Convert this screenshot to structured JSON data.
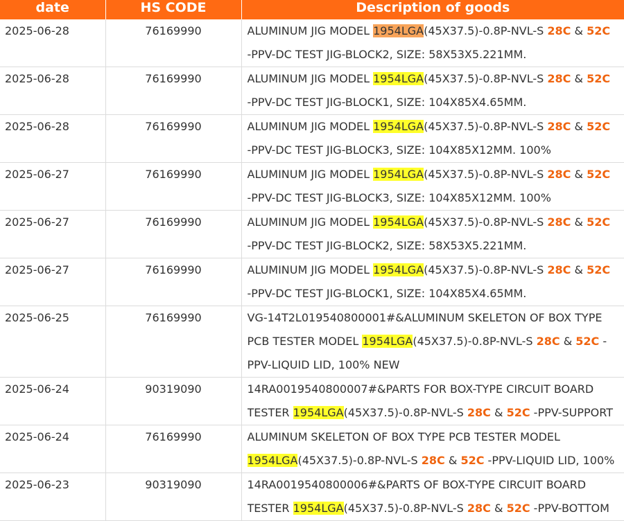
{
  "headers": {
    "date": "date",
    "hs_code": "HS CODE",
    "description": "Description of goods"
  },
  "rows": [
    {
      "date": "2025-06-28",
      "hs_code": "76169990",
      "highlight": "orange",
      "lines": [
        [
          {
            "t": "ALUMINUM JIG MODEL "
          },
          {
            "t": "1954LGA",
            "s": "hl"
          },
          {
            "t": "(45X37.5)-0.8P-NVL-S "
          },
          {
            "t": "28C",
            "s": "temp"
          },
          {
            "t": " & "
          },
          {
            "t": "52C",
            "s": "temp"
          }
        ],
        [
          {
            "t": "-PPV-DC TEST JIG-BLOCK2, SIZE: 58X53X5.221MM."
          }
        ]
      ]
    },
    {
      "date": "2025-06-28",
      "hs_code": "76169990",
      "highlight": "yellow",
      "lines": [
        [
          {
            "t": "ALUMINUM JIG MODEL "
          },
          {
            "t": "1954LGA",
            "s": "hl"
          },
          {
            "t": "(45X37.5)-0.8P-NVL-S "
          },
          {
            "t": "28C",
            "s": "temp"
          },
          {
            "t": " & "
          },
          {
            "t": "52C",
            "s": "temp"
          }
        ],
        [
          {
            "t": "-PPV-DC TEST JIG-BLOCK1, SIZE: 104X85X4.65MM."
          }
        ]
      ]
    },
    {
      "date": "2025-06-28",
      "hs_code": "76169990",
      "highlight": "yellow",
      "lines": [
        [
          {
            "t": "ALUMINUM JIG MODEL "
          },
          {
            "t": "1954LGA",
            "s": "hl"
          },
          {
            "t": "(45X37.5)-0.8P-NVL-S "
          },
          {
            "t": "28C",
            "s": "temp"
          },
          {
            "t": " & "
          },
          {
            "t": "52C",
            "s": "temp"
          }
        ],
        [
          {
            "t": "-PPV-DC TEST JIG-BLOCK3, SIZE: 104X85X12MM. 100%"
          }
        ]
      ]
    },
    {
      "date": "2025-06-27",
      "hs_code": "76169990",
      "highlight": "yellow",
      "lines": [
        [
          {
            "t": "ALUMINUM JIG MODEL "
          },
          {
            "t": "1954LGA",
            "s": "hl"
          },
          {
            "t": "(45X37.5)-0.8P-NVL-S "
          },
          {
            "t": "28C",
            "s": "temp"
          },
          {
            "t": " & "
          },
          {
            "t": "52C",
            "s": "temp"
          }
        ],
        [
          {
            "t": "-PPV-DC TEST JIG-BLOCK3, SIZE: 104X85X12MM. 100%"
          }
        ]
      ]
    },
    {
      "date": "2025-06-27",
      "hs_code": "76169990",
      "highlight": "yellow",
      "lines": [
        [
          {
            "t": "ALUMINUM JIG MODEL "
          },
          {
            "t": "1954LGA",
            "s": "hl"
          },
          {
            "t": "(45X37.5)-0.8P-NVL-S "
          },
          {
            "t": "28C",
            "s": "temp"
          },
          {
            "t": " & "
          },
          {
            "t": "52C",
            "s": "temp"
          }
        ],
        [
          {
            "t": "-PPV-DC TEST JIG-BLOCK2, SIZE: 58X53X5.221MM."
          }
        ]
      ]
    },
    {
      "date": "2025-06-27",
      "hs_code": "76169990",
      "highlight": "yellow",
      "lines": [
        [
          {
            "t": "ALUMINUM JIG MODEL "
          },
          {
            "t": "1954LGA",
            "s": "hl"
          },
          {
            "t": "(45X37.5)-0.8P-NVL-S "
          },
          {
            "t": "28C",
            "s": "temp"
          },
          {
            "t": " & "
          },
          {
            "t": "52C",
            "s": "temp"
          }
        ],
        [
          {
            "t": "-PPV-DC TEST JIG-BLOCK1, SIZE: 104X85X4.65MM."
          }
        ]
      ]
    },
    {
      "date": "2025-06-25",
      "hs_code": "76169990",
      "highlight": "yellow",
      "lines": [
        [
          {
            "t": "VG-14T2L019540800001#&ALUMINUM SKELETON OF BOX TYPE"
          }
        ],
        [
          {
            "t": "PCB TESTER MODEL "
          },
          {
            "t": "1954LGA",
            "s": "hl"
          },
          {
            "t": "(45X37.5)-0.8P-NVL-S "
          },
          {
            "t": "28C",
            "s": "temp"
          },
          {
            "t": " & "
          },
          {
            "t": "52C",
            "s": "temp"
          },
          {
            "t": " -"
          }
        ],
        [
          {
            "t": "PPV-LIQUID LID, 100% NEW"
          }
        ]
      ]
    },
    {
      "date": "2025-06-24",
      "hs_code": "90319090",
      "highlight": "yellow",
      "lines": [
        [
          {
            "t": "14RA0019540800007#&PARTS FOR BOX-TYPE CIRCUIT BOARD"
          }
        ],
        [
          {
            "t": "TESTER "
          },
          {
            "t": "1954LGA",
            "s": "hl"
          },
          {
            "t": "(45X37.5)-0.8P-NVL-S "
          },
          {
            "t": "28C",
            "s": "temp"
          },
          {
            "t": " & "
          },
          {
            "t": "52C",
            "s": "temp"
          },
          {
            "t": " -PPV-SUPPORT"
          }
        ]
      ]
    },
    {
      "date": "2025-06-24",
      "hs_code": "76169990",
      "highlight": "yellow",
      "lines": [
        [
          {
            "t": "ALUMINUM SKELETON OF BOX TYPE PCB TESTER MODEL"
          }
        ],
        [
          {
            "t": "1954LGA",
            "s": "hl"
          },
          {
            "t": "(45X37.5)-0.8P-NVL-S "
          },
          {
            "t": "28C",
            "s": "temp"
          },
          {
            "t": " & "
          },
          {
            "t": "52C",
            "s": "temp"
          },
          {
            "t": " -PPV-LIQUID LID, 100%"
          }
        ]
      ]
    },
    {
      "date": "2025-06-23",
      "hs_code": "90319090",
      "highlight": "yellow",
      "lines": [
        [
          {
            "t": "14RA0019540800006#&PARTS OF BOX-TYPE CIRCUIT BOARD"
          }
        ],
        [
          {
            "t": "TESTER "
          },
          {
            "t": "1954LGA",
            "s": "hl"
          },
          {
            "t": "(45X37.5)-0.8P-NVL-S "
          },
          {
            "t": "28C",
            "s": "temp"
          },
          {
            "t": " & "
          },
          {
            "t": "52C",
            "s": "temp"
          },
          {
            "t": " -PPV-BOTTOM"
          }
        ]
      ]
    }
  ],
  "colors": {
    "header_bg": "#ff6a13",
    "highlight_yellow": "#ffff2a",
    "highlight_orange": "#f8a45a",
    "temp_text": "#f0640f"
  }
}
